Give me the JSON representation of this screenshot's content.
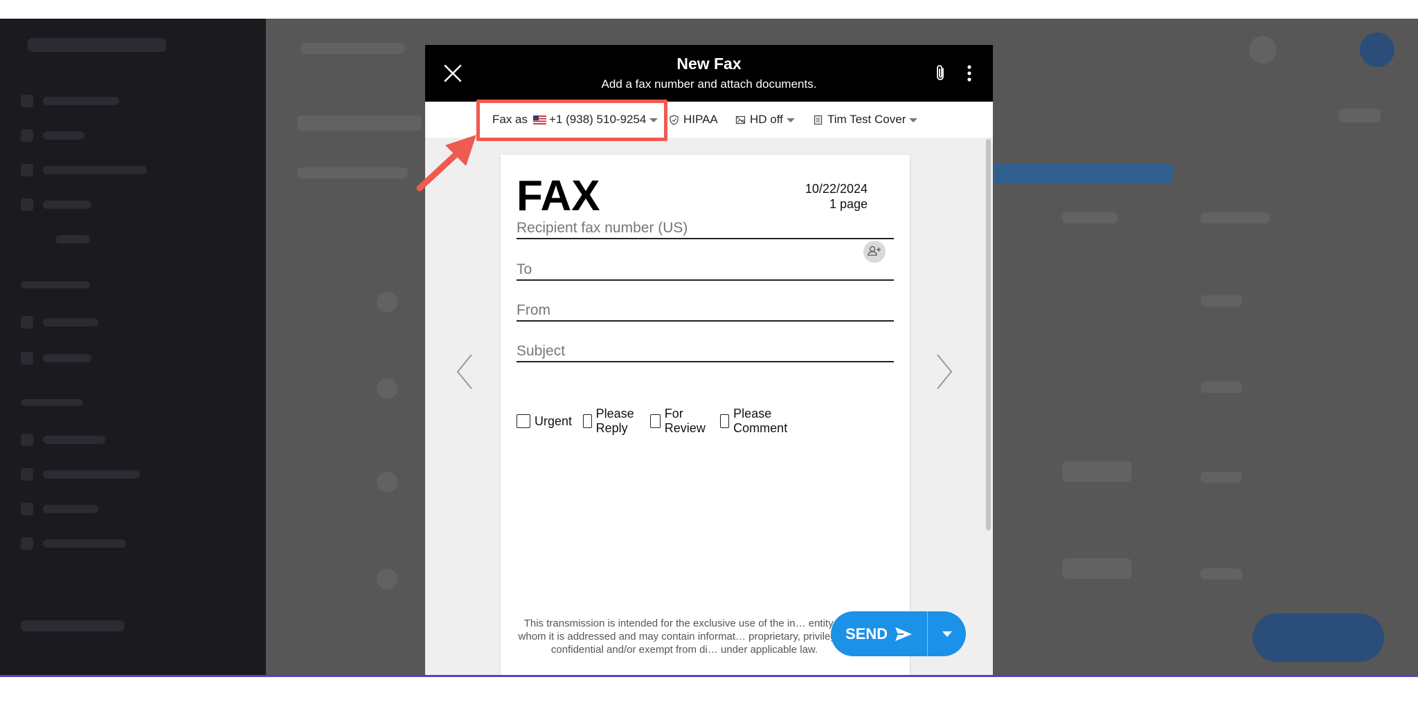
{
  "modal": {
    "title": "New Fax",
    "subtitle": "Add a fax number and attach documents."
  },
  "toolbar": {
    "fax_as_label": "Fax as",
    "fax_as_number": "+1 (938) 510-9254",
    "hipaa_label": "HIPAA",
    "hd_label": "HD off",
    "cover_label": "Tim Test Cover"
  },
  "document": {
    "heading": "FAX",
    "date": "10/22/2024",
    "pages": "1 page",
    "fields": {
      "recipient_placeholder": "Recipient fax number (US)",
      "to_placeholder": "To",
      "from_placeholder": "From",
      "subject_placeholder": "Subject"
    },
    "checkboxes": [
      "Urgent",
      "Please Reply",
      "For Review",
      "Please Comment"
    ],
    "disclaimer": "This transmission is intended for the exclusive use of the in… entity to whom it is addressed and may contain informat… proprietary, privileged, confidential and/or exempt from di… under applicable law."
  },
  "send": {
    "label": "SEND"
  },
  "colors": {
    "highlight": "#ef5b4f",
    "send_button": "#1b92e8",
    "header": "#000000"
  },
  "icons": [
    "close-icon",
    "paperclip-icon",
    "more-vertical-icon",
    "us-flag-icon",
    "shield-check-icon",
    "hd-icon",
    "cover-page-icon",
    "add-contact-icon",
    "chevron-left-icon",
    "chevron-right-icon",
    "send-arrow-icon",
    "caret-down-icon"
  ]
}
